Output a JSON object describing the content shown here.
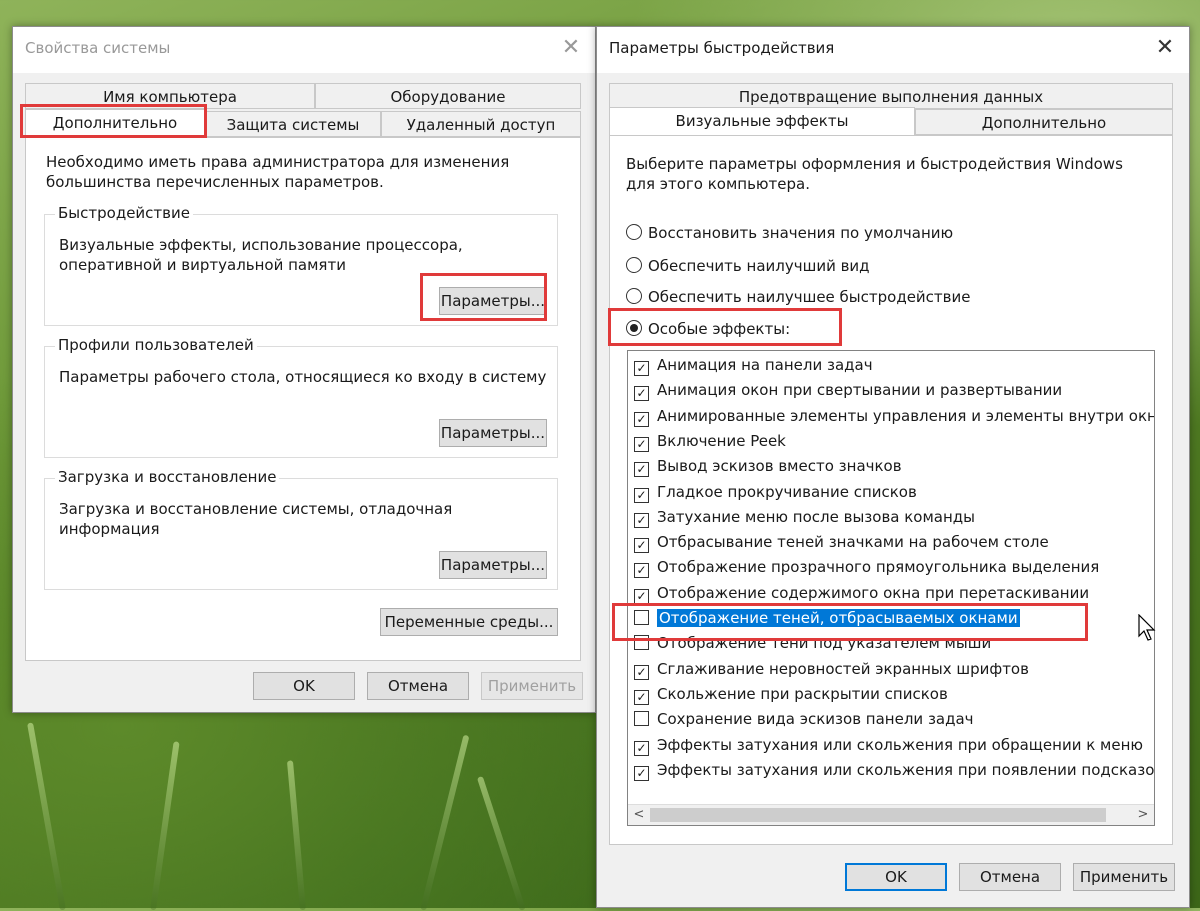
{
  "left_window": {
    "title": "Свойства системы",
    "tabs_row1": [
      "Имя компьютера",
      "Оборудование"
    ],
    "tabs_row2": [
      "Дополнительно",
      "Защита системы",
      "Удаленный доступ"
    ],
    "intro": "Необходимо иметь права администратора для изменения большинства перечисленных параметров.",
    "groups": [
      {
        "label": "Быстродействие",
        "text": "Визуальные эффекты, использование процессора, оперативной и виртуальной памяти",
        "button": "Параметры..."
      },
      {
        "label": "Профили пользователей",
        "text": "Параметры рабочего стола, относящиеся ко входу в систему",
        "button": "Параметры..."
      },
      {
        "label": "Загрузка и восстановление",
        "text": "Загрузка и восстановление системы, отладочная информация",
        "button": "Параметры..."
      }
    ],
    "env_button": "Переменные среды...",
    "ok": "OK",
    "cancel": "Отмена",
    "apply": "Применить"
  },
  "right_window": {
    "title": "Параметры быстродействия",
    "tab_top": "Предотвращение выполнения данных",
    "tabs": [
      "Визуальные эффекты",
      "Дополнительно"
    ],
    "intro": "Выберите параметры оформления и быстродействия Windows для этого компьютера.",
    "radios": [
      {
        "label": "Восстановить значения по умолчанию",
        "checked": false
      },
      {
        "label": "Обеспечить наилучший вид",
        "checked": false
      },
      {
        "label": "Обеспечить наилучшее быстродействие",
        "checked": false
      },
      {
        "label": "Особые эффекты:",
        "checked": true
      }
    ],
    "effects": [
      {
        "label": "Анимация на панели задач",
        "checked": true
      },
      {
        "label": "Анимация окон при свертывании и развертывании",
        "checked": true
      },
      {
        "label": "Анимированные элементы управления и элементы внутри окн",
        "checked": true
      },
      {
        "label": "Включение Peek",
        "checked": true
      },
      {
        "label": "Вывод эскизов вместо значков",
        "checked": true
      },
      {
        "label": "Гладкое прокручивание списков",
        "checked": true
      },
      {
        "label": "Затухание меню после вызова команды",
        "checked": true
      },
      {
        "label": "Отбрасывание теней значками на рабочем столе",
        "checked": true
      },
      {
        "label": "Отображение прозрачного прямоугольника выделения",
        "checked": true
      },
      {
        "label": "Отображение содержимого окна при перетаскивании",
        "checked": true
      },
      {
        "label": "Отображение теней, отбрасываемых окнами",
        "checked": false
      },
      {
        "label": "Отображение тени под указателем мыши",
        "checked": false
      },
      {
        "label": "Сглаживание неровностей экранных шрифтов",
        "checked": true
      },
      {
        "label": "Скольжение при раскрытии списков",
        "checked": true
      },
      {
        "label": "Сохранение вида эскизов панели задач",
        "checked": false
      },
      {
        "label": "Эффекты затухания или скольжения при обращении к меню",
        "checked": true
      },
      {
        "label": "Эффекты затухания или скольжения при появлении подсказок",
        "checked": true
      }
    ],
    "selected_effect_index": 10,
    "ok": "OK",
    "cancel": "Отмена",
    "apply": "Применить"
  },
  "colors": {
    "highlight": "#e03a3a",
    "selection": "#0078d7"
  }
}
